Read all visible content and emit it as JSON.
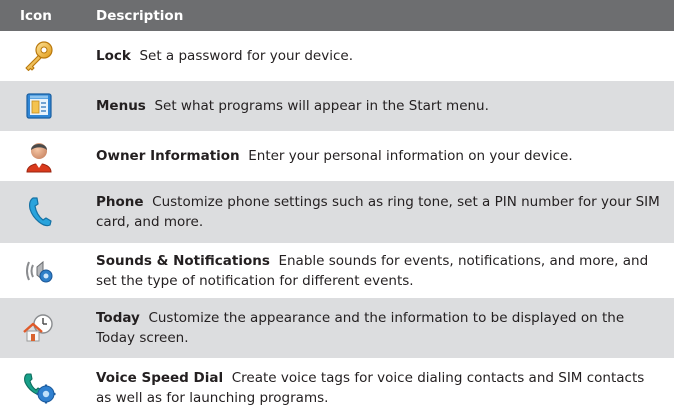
{
  "header": {
    "icon_col": "Icon",
    "desc_col": "Description"
  },
  "rows": [
    {
      "title": "Lock",
      "text": "Set a password for your device.",
      "icon": "key-icon"
    },
    {
      "title": "Menus",
      "text": "Set what programs will appear in the Start menu.",
      "icon": "menus-icon"
    },
    {
      "title": "Owner Information",
      "text": "Enter your personal information on your device.",
      "icon": "owner-icon"
    },
    {
      "title": "Phone",
      "text": "Customize phone settings such as ring tone, set a PIN number for your SIM card, and more.",
      "icon": "phone-icon"
    },
    {
      "title": "Sounds & Notifications",
      "text": "Enable sounds for events, notifications, and more, and set the type of notification for different events.",
      "icon": "speaker-icon"
    },
    {
      "title": "Today",
      "text": "Customize the appearance and the information to be displayed on the Today screen.",
      "icon": "home-clock-icon"
    },
    {
      "title": "Voice Speed Dial",
      "text": "Create voice tags for voice dialing contacts and SIM contacts as well as for launching programs.",
      "icon": "voice-dial-icon"
    }
  ]
}
